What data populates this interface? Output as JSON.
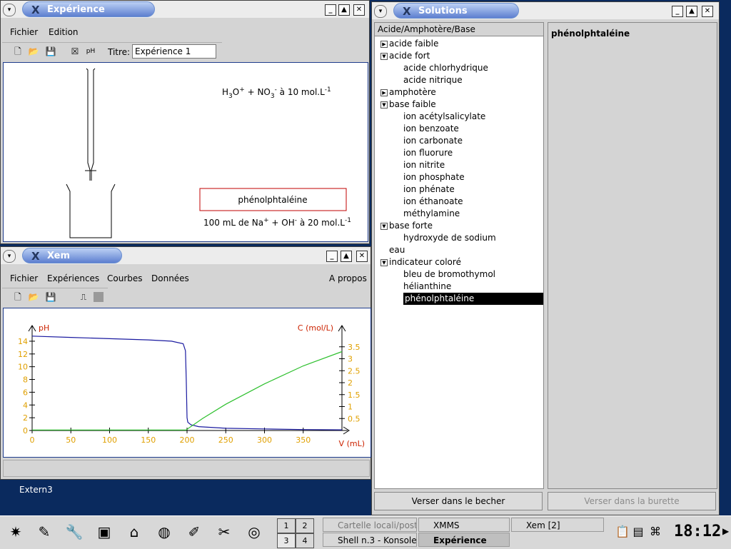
{
  "desktop": {
    "extern_label": "Extern3"
  },
  "experience_window": {
    "title": "Expérience",
    "menu": [
      "Fichier",
      "Edition"
    ],
    "titre_label": "Titre:",
    "titre_value": "Expérience 1",
    "acid_label_main": "H",
    "acid_label_full": "H3O+ + NO3- à 10 mol.L-1",
    "indicator": "phénolphtaléine",
    "base_label": "100 mL de Na+ + OH- à 20 mol.L-1"
  },
  "xem_window": {
    "title": "Xem",
    "menu": [
      "Fichier",
      "Expériences",
      "Courbes",
      "Données"
    ],
    "about": "A propos"
  },
  "chart_data": {
    "type": "line",
    "xlabel": "V (mL)",
    "ylabel_left": "pH",
    "ylabel_right": "C (mol/L)",
    "x_ticks": [
      0,
      50,
      100,
      150,
      200,
      250,
      300,
      350
    ],
    "y_left_ticks": [
      0,
      2,
      4,
      6,
      8,
      10,
      12,
      14
    ],
    "y_right_ticks": [
      "0.5",
      "1",
      "1.5",
      "2",
      "2.5",
      "3",
      "3.5"
    ],
    "xlim": [
      0,
      400
    ],
    "ylim_left": [
      0,
      15
    ],
    "ylim_right": [
      0,
      4
    ],
    "series": [
      {
        "color": "#1a1aa0",
        "axis": "left",
        "x": [
          0,
          50,
          100,
          150,
          180,
          195,
          198,
          199,
          200,
          201,
          205,
          215,
          250,
          300,
          350,
          400
        ],
        "y": [
          14.8,
          14.6,
          14.4,
          14.2,
          14.0,
          13.6,
          12.5,
          8,
          2,
          1.3,
          0.9,
          0.6,
          0.35,
          0.25,
          0.15,
          0.1
        ]
      },
      {
        "color": "#2ec02e",
        "axis": "right",
        "x": [
          0,
          100,
          199,
          200,
          220,
          250,
          300,
          350,
          400
        ],
        "y": [
          0.02,
          0.02,
          0.02,
          0.05,
          0.5,
          1.1,
          1.95,
          2.7,
          3.3
        ]
      }
    ]
  },
  "solutions_window": {
    "title": "Solutions",
    "header": "Acide/Amphotère/Base",
    "selected_name": "phénolphtaléine",
    "tree": [
      {
        "label": "acide faible",
        "level": 0,
        "toggle": "collapsed"
      },
      {
        "label": "acide fort",
        "level": 0,
        "toggle": "expanded"
      },
      {
        "label": "acide chlorhydrique",
        "level": 1
      },
      {
        "label": "acide nitrique",
        "level": 1
      },
      {
        "label": "amphotère",
        "level": 0,
        "toggle": "collapsed"
      },
      {
        "label": "base faible",
        "level": 0,
        "toggle": "expanded"
      },
      {
        "label": "ion acétylsalicylate",
        "level": 1
      },
      {
        "label": "ion benzoate",
        "level": 1
      },
      {
        "label": "ion carbonate",
        "level": 1
      },
      {
        "label": "ion fluorure",
        "level": 1
      },
      {
        "label": "ion nitrite",
        "level": 1
      },
      {
        "label": "ion phosphate",
        "level": 1
      },
      {
        "label": "ion phénate",
        "level": 1
      },
      {
        "label": "ion éthanoate",
        "level": 1
      },
      {
        "label": "méthylamine",
        "level": 1
      },
      {
        "label": "base forte",
        "level": 0,
        "toggle": "expanded"
      },
      {
        "label": "hydroxyde de sodium",
        "level": 1
      },
      {
        "label": "eau",
        "level": 0
      },
      {
        "label": "indicateur coloré",
        "level": 0,
        "toggle": "expanded"
      },
      {
        "label": "bleu de bromothymol",
        "level": 1
      },
      {
        "label": "hélianthine",
        "level": 1
      },
      {
        "label": "phénolphtaléine",
        "level": 1,
        "selected": true
      }
    ],
    "btn_becher": "Verser dans le becher",
    "btn_burette": "Verser dans la burette"
  },
  "taskbar": {
    "pager": [
      "1",
      "2",
      "3",
      "4"
    ],
    "tasks": [
      {
        "label": "Cartelle locali/posta"
      },
      {
        "label": "XMMS"
      },
      {
        "label": "Xem [2]"
      },
      {
        "label": "Shell n.3 - Konsole"
      },
      {
        "label": "Expérience"
      }
    ],
    "clock": "18:12"
  },
  "colors": {
    "accent": "#5d7fd0",
    "plot_pH": "#1a1aa0",
    "plot_C": "#2ec02e",
    "tick": "#e0a000",
    "axis_label": "#cc2200"
  }
}
